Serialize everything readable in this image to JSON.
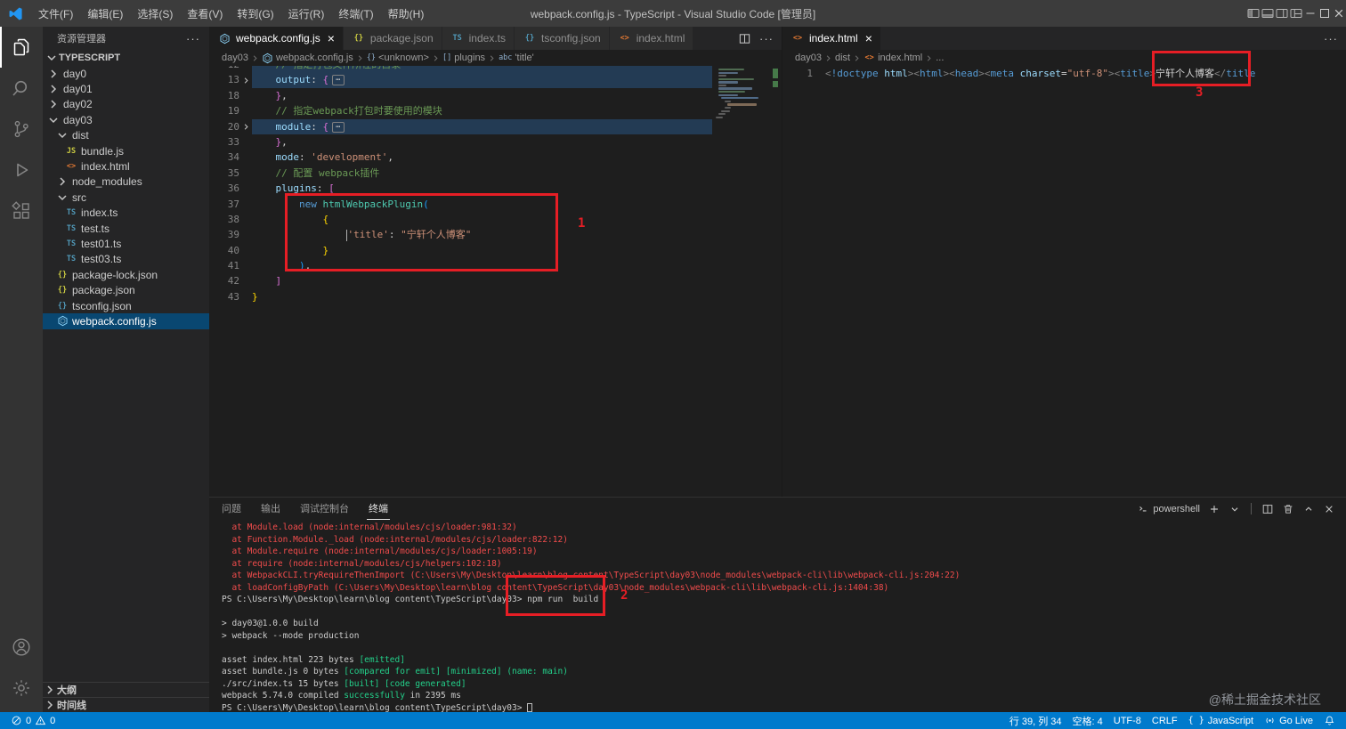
{
  "colors": {
    "accent": "#007acc",
    "annotation_red": "#e61e25",
    "terminal_error": "#f14c4c",
    "terminal_success": "#23d18b"
  },
  "title_bar": {
    "menus": [
      "文件(F)",
      "编辑(E)",
      "选择(S)",
      "查看(V)",
      "转到(G)",
      "运行(R)",
      "终端(T)",
      "帮助(H)"
    ],
    "title": "webpack.config.js - TypeScript - Visual Studio Code [管理员]"
  },
  "activity_bar": {
    "top": [
      {
        "name": "explorer",
        "active": true
      },
      {
        "name": "search",
        "active": false
      },
      {
        "name": "source-control",
        "active": false
      },
      {
        "name": "run-debug",
        "active": false
      },
      {
        "name": "extensions",
        "active": false
      }
    ],
    "bottom": [
      {
        "name": "account",
        "active": false
      },
      {
        "name": "settings",
        "active": false
      }
    ]
  },
  "sidebar": {
    "title": "资源管理器",
    "section": "TYPESCRIPT",
    "tree": [
      {
        "label": "day0",
        "indent": 0,
        "chevron": "right"
      },
      {
        "label": "day01",
        "indent": 0,
        "chevron": "right"
      },
      {
        "label": "day02",
        "indent": 0,
        "chevron": "right"
      },
      {
        "label": "day03",
        "indent": 0,
        "chevron": "down"
      },
      {
        "label": "dist",
        "indent": 1,
        "chevron": "down"
      },
      {
        "label": "bundle.js",
        "indent": 2,
        "icon": "js"
      },
      {
        "label": "index.html",
        "indent": 2,
        "icon": "html"
      },
      {
        "label": "node_modules",
        "indent": 1,
        "chevron": "right"
      },
      {
        "label": "src",
        "indent": 1,
        "chevron": "down"
      },
      {
        "label": "index.ts",
        "indent": 2,
        "icon": "ts"
      },
      {
        "label": "test.ts",
        "indent": 2,
        "icon": "ts"
      },
      {
        "label": "test01.ts",
        "indent": 2,
        "icon": "ts"
      },
      {
        "label": "test03.ts",
        "indent": 2,
        "icon": "ts"
      },
      {
        "label": "package-lock.json",
        "indent": 1,
        "icon": "json"
      },
      {
        "label": "package.json",
        "indent": 1,
        "icon": "json"
      },
      {
        "label": "tsconfig.json",
        "indent": 1,
        "icon": "tsconfig"
      },
      {
        "label": "webpack.config.js",
        "indent": 1,
        "icon": "webpack",
        "selected": true
      }
    ],
    "footer_sections": [
      "大纲",
      "时间线"
    ]
  },
  "editor_group_1": {
    "tabs": [
      {
        "label": "webpack.config.js",
        "icon": "webpack",
        "active": true
      },
      {
        "label": "package.json",
        "icon": "json",
        "active": false
      },
      {
        "label": "index.ts",
        "icon": "ts",
        "active": false
      },
      {
        "label": "tsconfig.json",
        "icon": "tsconfig",
        "active": false
      },
      {
        "label": "index.html",
        "icon": "html",
        "active": false
      }
    ],
    "breadcrumb": [
      {
        "label": "day03"
      },
      {
        "label": "webpack.config.js",
        "icon": "webpack"
      },
      {
        "label": "<unknown>",
        "icon": "symbol-object"
      },
      {
        "label": "plugins",
        "icon": "symbol-array"
      },
      {
        "label": "'title'",
        "icon": "symbol-string"
      }
    ],
    "code": [
      {
        "num": 12,
        "partial": true,
        "hl": true,
        "segs": [
          [
            "cm",
            "    // 指定打包文件所在的目录"
          ]
        ]
      },
      {
        "num": 13,
        "fold": true,
        "hl": true,
        "segs": [
          [
            "prop",
            "    output"
          ],
          [
            "pl",
            ": "
          ],
          [
            "b2",
            "{"
          ],
          [
            "fold",
            "⋯"
          ]
        ]
      },
      {
        "num": 18,
        "segs": [
          [
            "b2",
            "    }"
          ],
          [
            "pl",
            ","
          ]
        ]
      },
      {
        "num": 19,
        "segs": [
          [
            "cm",
            "    // 指定webpack打包时要使用的模块"
          ]
        ]
      },
      {
        "num": 20,
        "fold": true,
        "hl": true,
        "segs": [
          [
            "prop",
            "    module"
          ],
          [
            "pl",
            ": "
          ],
          [
            "b2",
            "{"
          ],
          [
            "fold",
            "⋯"
          ]
        ]
      },
      {
        "num": 33,
        "segs": [
          [
            "b2",
            "    }"
          ],
          [
            "pl",
            ","
          ]
        ]
      },
      {
        "num": 34,
        "segs": [
          [
            "prop",
            "    mode"
          ],
          [
            "pl",
            ": "
          ],
          [
            "str",
            "'development'"
          ],
          [
            "pl",
            ","
          ]
        ]
      },
      {
        "num": 35,
        "segs": [
          [
            "cm",
            "    // 配置 webpack插件"
          ]
        ]
      },
      {
        "num": 36,
        "segs": [
          [
            "prop",
            "    plugins"
          ],
          [
            "pl",
            ": "
          ],
          [
            "b2",
            "["
          ]
        ]
      },
      {
        "num": 37,
        "segs": [
          [
            "pl",
            "        "
          ],
          [
            "kw",
            "new "
          ],
          [
            "cls",
            "htmlWebpackPlugin"
          ],
          [
            "b3",
            "("
          ]
        ]
      },
      {
        "num": 38,
        "segs": [
          [
            "b1",
            "            {"
          ]
        ]
      },
      {
        "num": 39,
        "segs": [
          [
            "pl",
            "                "
          ],
          [
            "cur",
            ""
          ],
          [
            "str",
            "'title'"
          ],
          [
            "pl",
            ": "
          ],
          [
            "str",
            "\"宁轩个人博客\""
          ]
        ]
      },
      {
        "num": 40,
        "segs": [
          [
            "b1",
            "            }"
          ]
        ]
      },
      {
        "num": 41,
        "segs": [
          [
            "b3",
            "        )"
          ],
          [
            "pl",
            ","
          ]
        ]
      },
      {
        "num": 42,
        "segs": [
          [
            "b2",
            "    ]"
          ]
        ]
      },
      {
        "num": 43,
        "segs": [
          [
            "b1",
            "}"
          ]
        ]
      }
    ]
  },
  "editor_group_2": {
    "tabs": [
      {
        "label": "index.html",
        "icon": "html",
        "active": true
      }
    ],
    "breadcrumb": [
      {
        "label": "day03"
      },
      {
        "label": "dist"
      },
      {
        "label": "index.html",
        "icon": "html"
      },
      {
        "label": "..."
      }
    ],
    "code": [
      {
        "num": 1,
        "segs": [
          [
            "pu",
            "<"
          ],
          [
            "kw",
            "!doctype"
          ],
          [
            "attr",
            " html"
          ],
          [
            "pu",
            "><"
          ],
          [
            "tag",
            "html"
          ],
          [
            "pu",
            "><"
          ],
          [
            "tag",
            "head"
          ],
          [
            "pu",
            "><"
          ],
          [
            "tag",
            "meta"
          ],
          [
            "attr",
            " charset"
          ],
          [
            "pl",
            "="
          ],
          [
            "str",
            "\"utf-8\""
          ],
          [
            "pu",
            "><"
          ],
          [
            "tag",
            "title"
          ],
          [
            "pu",
            ">"
          ],
          [
            "pl",
            "宁轩个人博客"
          ],
          [
            "pu",
            "</"
          ],
          [
            "tag",
            "title"
          ]
        ]
      }
    ]
  },
  "panel": {
    "tabs": [
      {
        "label": "问题",
        "active": false
      },
      {
        "label": "输出",
        "active": false
      },
      {
        "label": "调试控制台",
        "active": false
      },
      {
        "label": "终端",
        "active": true
      }
    ],
    "shell_selector": "powershell",
    "terminal": [
      [
        [
          "err",
          "  at Module.load (node:internal/modules/cjs/loader:981:32)"
        ]
      ],
      [
        [
          "err",
          "  at Function.Module._load (node:internal/modules/cjs/loader:822:12)"
        ]
      ],
      [
        [
          "err",
          "  at Module.require (node:internal/modules/cjs/loader:1005:19)"
        ]
      ],
      [
        [
          "err",
          "  at require (node:internal/modules/cjs/helpers:102:18)"
        ]
      ],
      [
        [
          "err",
          "  at WebpackCLI.tryRequireThenImport (C:\\Users\\My\\Desktop\\learn\\blog content\\TypeScript\\day03\\node_modules\\webpack-cli\\lib\\webpack-cli.js:204:22)"
        ]
      ],
      [
        [
          "err",
          "  at loadConfigByPath (C:\\Users\\My\\Desktop\\learn\\blog content\\TypeScript\\day03\\node_modules\\webpack-cli\\lib\\webpack-cli.js:1404:38)"
        ]
      ],
      [
        [
          "pl",
          "PS C:\\Users\\My\\Desktop\\learn\\blog content\\TypeScript\\day03> npm run  build"
        ]
      ],
      [],
      [
        [
          "pl",
          "> day03@1.0.0 build"
        ]
      ],
      [
        [
          "pl",
          "> webpack --mode production"
        ]
      ],
      [],
      [
        [
          "pl",
          "asset index.html 223 bytes "
        ],
        [
          "grn",
          "[emitted]"
        ]
      ],
      [
        [
          "pl",
          "asset bundle.js 0 bytes "
        ],
        [
          "grn",
          "[compared for emit]"
        ],
        [
          "pl",
          " "
        ],
        [
          "grn",
          "[minimized]"
        ],
        [
          "grn",
          " (name: main)"
        ]
      ],
      [
        [
          "pl",
          "./src/index.ts 15 bytes "
        ],
        [
          "grn",
          "[built] [code generated]"
        ]
      ],
      [
        [
          "pl",
          "webpack 5.74.0 compiled "
        ],
        [
          "grn",
          "successfully"
        ],
        [
          "pl",
          " in 2395 ms"
        ]
      ],
      [
        [
          "pl",
          "PS C:\\Users\\My\\Desktop\\learn\\blog content\\TypeScript\\day03> "
        ],
        [
          "cur",
          ""
        ]
      ]
    ]
  },
  "status_bar": {
    "errors": "0",
    "warnings": "0",
    "cursor_position": "行 39, 列 34",
    "indentation": "空格: 4",
    "encoding": "UTF-8",
    "eol": "CRLF",
    "language": "JavaScript",
    "go_live": "Go Live"
  },
  "annotations": [
    {
      "label": "1"
    },
    {
      "label": "2"
    },
    {
      "label": "3"
    }
  ],
  "watermark": "@稀土掘金技术社区"
}
